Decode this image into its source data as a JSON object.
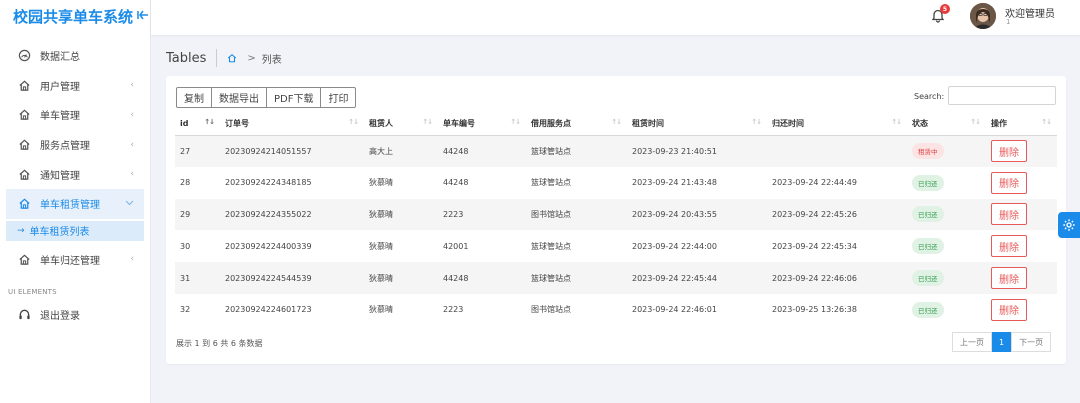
{
  "app": {
    "brand": "校园共享单车系统",
    "collapse_icon": "collapse-icon"
  },
  "sidebar": {
    "items": [
      {
        "label": "数据汇总",
        "icon": "dashboard-icon",
        "has_chevron": false
      },
      {
        "label": "用户管理",
        "icon": "home-icon",
        "has_chevron": true
      },
      {
        "label": "单车管理",
        "icon": "home-icon",
        "has_chevron": true
      },
      {
        "label": "服务点管理",
        "icon": "home-icon",
        "has_chevron": true
      },
      {
        "label": "通知管理",
        "icon": "home-icon",
        "has_chevron": true
      },
      {
        "label": "单车租赁管理",
        "icon": "home-icon",
        "has_chevron": true,
        "active": true
      },
      {
        "label": "单车归还管理",
        "icon": "home-icon",
        "has_chevron": true
      }
    ],
    "active_submenu": {
      "label": "单车租赁列表"
    },
    "section_title": "UI ELEMENTS",
    "logout": {
      "label": "退出登录",
      "icon": "headset-icon"
    }
  },
  "topbar": {
    "notification_count": "5",
    "welcome": "欢迎管理员",
    "welcome_sub": "1"
  },
  "page": {
    "title": "Tables",
    "breadcrumb_current": "列表"
  },
  "toolbar": {
    "buttons": [
      "复制",
      "数据导出",
      "PDF下载",
      "打印"
    ],
    "search_label": "Search:",
    "search_value": ""
  },
  "table": {
    "headers": [
      "id",
      "订单号",
      "租赁人",
      "单车编号",
      "借用服务点",
      "租赁时间",
      "归还时间",
      "状态",
      "操作"
    ],
    "rows": [
      {
        "id": "27",
        "order": "20230924214051557",
        "renter": "高大上",
        "bike": "44248",
        "point": "篮球管站点",
        "rent_time": "2023-09-23 21:40:51",
        "return_time": "",
        "status": "租赁中",
        "status_type": "renting",
        "action": "删除"
      },
      {
        "id": "28",
        "order": "20230924224348185",
        "renter": "狄慕晴",
        "bike": "44248",
        "point": "篮球管站点",
        "rent_time": "2023-09-24 21:43:48",
        "return_time": "2023-09-24 22:44:49",
        "status": "已归还",
        "status_type": "returned",
        "action": "删除"
      },
      {
        "id": "29",
        "order": "20230924224355022",
        "renter": "狄慕晴",
        "bike": "2223",
        "point": "图书馆站点",
        "rent_time": "2023-09-24 20:43:55",
        "return_time": "2023-09-24 22:45:26",
        "status": "已归还",
        "status_type": "returned",
        "action": "删除"
      },
      {
        "id": "30",
        "order": "20230924224400339",
        "renter": "狄慕晴",
        "bike": "42001",
        "point": "篮球管站点",
        "rent_time": "2023-09-24 22:44:00",
        "return_time": "2023-09-24 22:45:34",
        "status": "已归还",
        "status_type": "returned",
        "action": "删除"
      },
      {
        "id": "31",
        "order": "20230924224544539",
        "renter": "狄慕晴",
        "bike": "44248",
        "point": "篮球管站点",
        "rent_time": "2023-09-24 22:45:44",
        "return_time": "2023-09-24 22:46:06",
        "status": "已归还",
        "status_type": "returned",
        "action": "删除"
      },
      {
        "id": "32",
        "order": "20230924224601723",
        "renter": "狄慕晴",
        "bike": "2223",
        "point": "图书馆站点",
        "rent_time": "2023-09-24 22:46:01",
        "return_time": "2023-09-25 13:26:38",
        "status": "已归还",
        "status_type": "returned",
        "action": "删除"
      }
    ],
    "info": "展示 1 到 6 共 6 条数据"
  },
  "pagination": {
    "prev": "上一页",
    "current": "1",
    "next": "下一页"
  },
  "colors": {
    "accent": "#1a8be8",
    "danger": "#e85a5a",
    "success": "#2f9a4c"
  }
}
